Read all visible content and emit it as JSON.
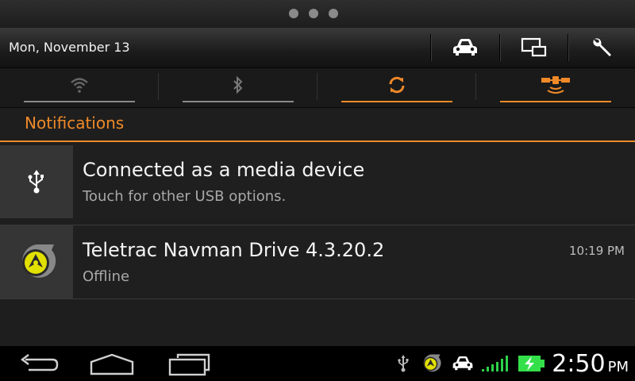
{
  "header": {
    "date": "Mon, November 13",
    "buttons": [
      {
        "icon": "car-icon"
      },
      {
        "icon": "screen-mirror-icon"
      },
      {
        "icon": "wrench-icon"
      }
    ]
  },
  "toggles": [
    {
      "icon": "wifi-icon",
      "active": false
    },
    {
      "icon": "bluetooth-icon",
      "active": false
    },
    {
      "icon": "sync-icon",
      "active": true
    },
    {
      "icon": "gps-satellite-icon",
      "active": true
    }
  ],
  "notifications": {
    "title": "Notifications",
    "items": [
      {
        "icon": "usb-icon",
        "title": "Connected as a media device",
        "subtitle": "Touch for other USB options.",
        "time": ""
      },
      {
        "icon": "teletrac-navman-logo-icon",
        "title": "Teletrac Navman Drive 4.3.20.2",
        "subtitle": "Offline",
        "time": "10:19 PM"
      }
    ]
  },
  "navbar": {
    "buttons": [
      "back-icon",
      "home-icon",
      "recent-apps-icon"
    ]
  },
  "status": {
    "icons": [
      "usb-icon",
      "navman-icon",
      "car-icon",
      "signal-icon",
      "battery-charging-icon"
    ],
    "time": "2:50",
    "ampm": "PM"
  },
  "colors": {
    "accent": "#f08a28",
    "active_indicator": "#f08a28",
    "signal": "#2bd24a",
    "battery": "#34e04a",
    "navman_yellow": "#e2e000"
  }
}
